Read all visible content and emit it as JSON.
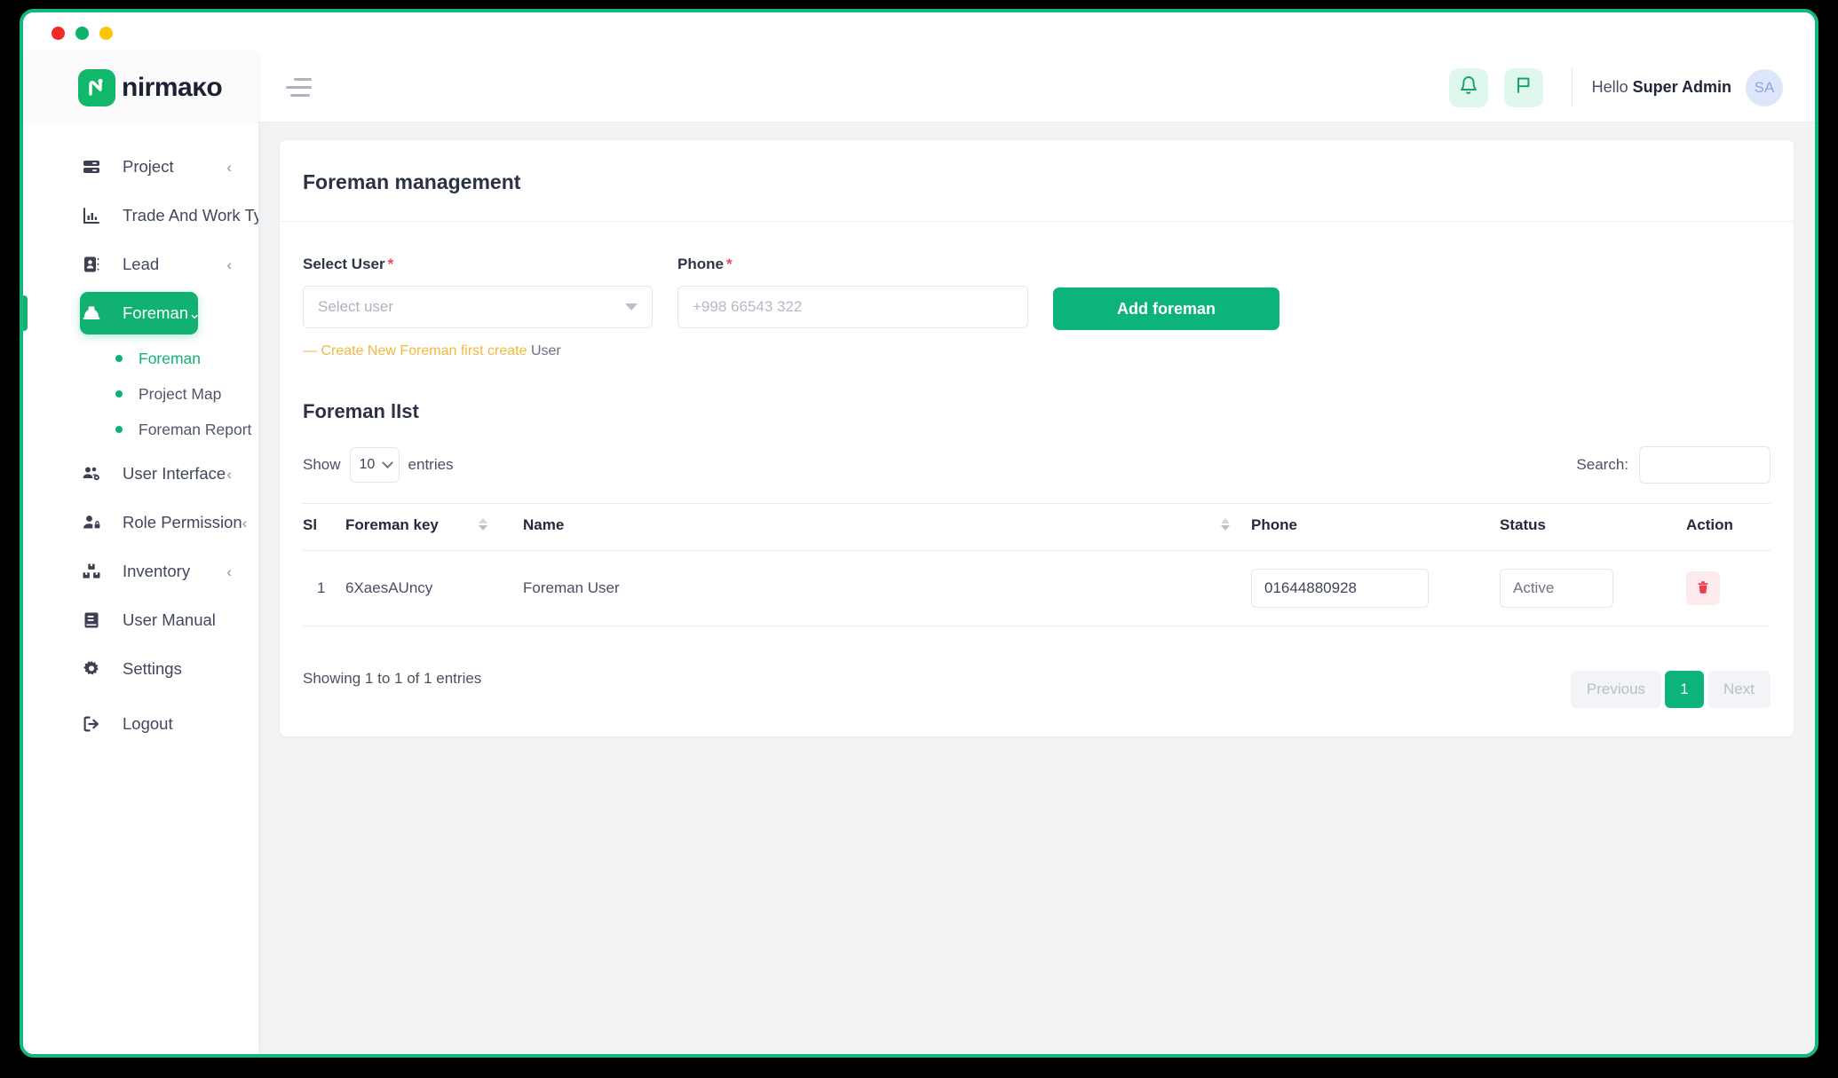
{
  "window": {
    "traffic_lights": [
      "red",
      "green",
      "yellow"
    ]
  },
  "sidebar": {
    "logo_text": "nirmaĸo",
    "items": [
      {
        "label": "Project",
        "icon": "server-stack-icon",
        "chevron": "‹",
        "active": false
      },
      {
        "label": "Trade And Work Type",
        "icon": "bar-chart-icon",
        "chevron": "",
        "active": false
      },
      {
        "label": "Lead",
        "icon": "contact-card-icon",
        "chevron": "‹",
        "active": false
      },
      {
        "label": "Foreman",
        "icon": "hard-hat-icon",
        "chevron": "⌄",
        "active": true
      },
      {
        "label": "User Interface",
        "icon": "users-gear-icon",
        "chevron": "‹",
        "active": false
      },
      {
        "label": "Role Permission",
        "icon": "user-lock-icon",
        "chevron": "‹",
        "active": false
      },
      {
        "label": "Inventory",
        "icon": "boxes-icon",
        "chevron": "‹",
        "active": false
      },
      {
        "label": "User Manual",
        "icon": "book-icon",
        "chevron": "",
        "active": false
      },
      {
        "label": "Settings",
        "icon": "gear-icon",
        "chevron": "",
        "active": false
      },
      {
        "label": "Logout",
        "icon": "logout-icon",
        "chevron": "",
        "active": false
      }
    ],
    "submenu": [
      {
        "label": "Foreman",
        "active": true
      },
      {
        "label": "Project Map",
        "active": false
      },
      {
        "label": "Foreman Report",
        "active": false
      }
    ]
  },
  "topbar": {
    "menu_icon": "hamburger-icon",
    "notification_icon": "bell-icon",
    "flag_icon": "flag-icon",
    "greeting_prefix": "Hello ",
    "user_name": "Super Admin",
    "avatar_initials": "SA"
  },
  "page": {
    "title": "Foreman management",
    "form": {
      "select_user_label": "Select User",
      "select_user_required": "*",
      "select_user_value": "Select user",
      "phone_label": "Phone",
      "phone_required": "*",
      "phone_placeholder": "+998 66543 322",
      "phone_value": "",
      "submit_label": "Add foreman",
      "helper_text": "— Create New Foreman first create ",
      "helper_suffix": "User"
    },
    "list": {
      "title": "Foreman lIst",
      "show_label": "Show",
      "entries_value": "10",
      "entries_label": "entries",
      "search_label": "Search:",
      "search_value": "",
      "search_placeholder": "",
      "columns": [
        "Sl",
        "Foreman key",
        "Name",
        "Phone",
        "Status",
        "Action"
      ],
      "rows": [
        {
          "sl": "1",
          "foreman_key": "6XaesAUncy",
          "name": "Foreman User",
          "phone": "01644880928",
          "status": "Active",
          "action_icon": "trash-icon"
        }
      ],
      "showing_text": "Showing 1 to 1 of 1 entries",
      "pagination": {
        "previous": "Previous",
        "current": "1",
        "next": "Next"
      }
    }
  },
  "colors": {
    "brand_green": "#0cb37a",
    "active_green": "#11b271",
    "warning_amber": "#f4b83e",
    "danger_red": "#f2415a",
    "avatar_blue": "#dde6fb"
  }
}
